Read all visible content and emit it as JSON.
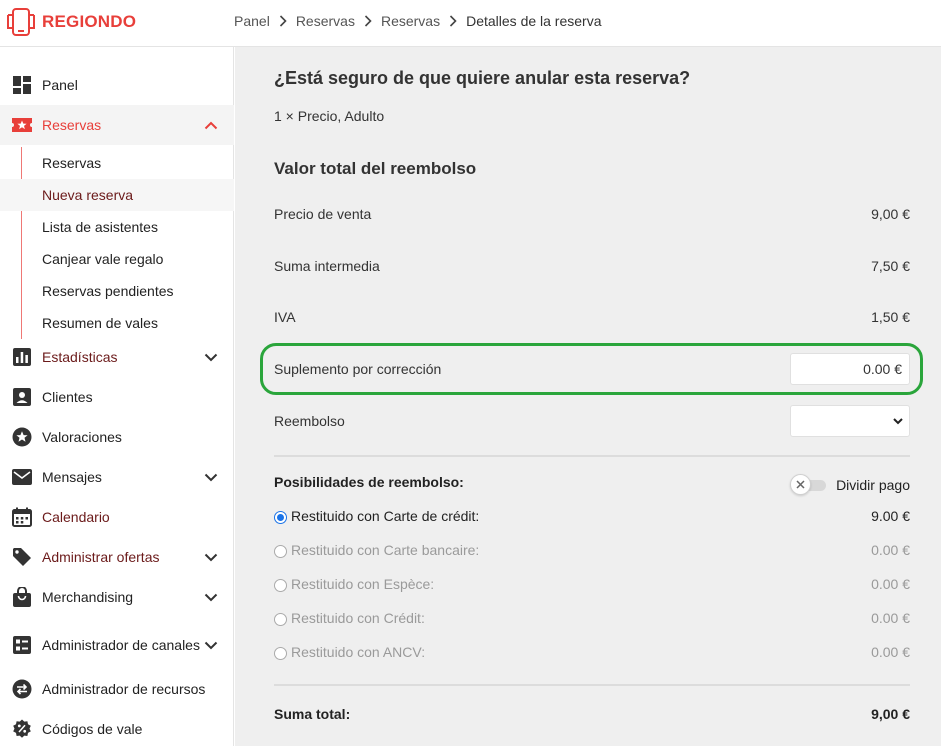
{
  "brand": {
    "name": "REGIONDO",
    "color": "#e83f3a"
  },
  "breadcrumb": [
    "Panel",
    "Reservas",
    "Reservas",
    "Detalles de la reserva"
  ],
  "sidebar": {
    "items": [
      {
        "label": "Panel",
        "icon": "dashboard-icon"
      },
      {
        "label": "Reservas",
        "icon": "star-ticket-icon"
      },
      {
        "label": "Estadísticas",
        "icon": "bar-chart-icon"
      },
      {
        "label": "Clientes",
        "icon": "contact-card-icon"
      },
      {
        "label": "Valoraciones",
        "icon": "star-circle-icon"
      },
      {
        "label": "Mensajes",
        "icon": "mail-icon"
      },
      {
        "label": "Calendario",
        "icon": "calendar-icon"
      },
      {
        "label": "Administrar ofertas",
        "icon": "tag-icon"
      },
      {
        "label": "Merchandising",
        "icon": "shopping-bag-icon"
      },
      {
        "label": "Administrador de canales",
        "icon": "channels-icon"
      },
      {
        "label": "Administrador de recursos",
        "icon": "swap-icon"
      },
      {
        "label": "Códigos de vale",
        "icon": "percent-icon"
      }
    ],
    "reservas_sub": [
      "Reservas",
      "Nueva reserva",
      "Lista de asistentes",
      "Canjear vale regalo",
      "Reservas pendientes",
      "Resumen de vales"
    ]
  },
  "main": {
    "question": "¿Está seguro de que quiere anular esta reserva?",
    "item_line": "1 × Precio, Adulto",
    "refund_heading": "Valor total del reembolso",
    "rows": [
      {
        "label": "Precio de venta",
        "value": "9,00 €"
      },
      {
        "label": "Suma intermedia",
        "value": "7,50 €"
      },
      {
        "label": "IVA",
        "value": "1,50 €"
      }
    ],
    "correction": {
      "label": "Suplemento por corrección",
      "value": "0.00  €"
    },
    "refund_label": "Reembolso",
    "refund_select_value": "",
    "options_title": "Posibilidades de reembolso:",
    "split_payment_label": "Dividir pago",
    "options": [
      {
        "label": "Restituido con Carte de crédit:",
        "value": "9.00 €",
        "checked": true
      },
      {
        "label": "Restituido con Carte bancaire:",
        "value": "0.00 €",
        "checked": false
      },
      {
        "label": "Restituido con Espèce:",
        "value": "0.00 €",
        "checked": false
      },
      {
        "label": "Restituido con Crédit:",
        "value": "0.00 €",
        "checked": false
      },
      {
        "label": "Restituido con ANCV:",
        "value": "0.00 €",
        "checked": false
      }
    ],
    "total_label": "Suma total:",
    "total_value": "9,00 €"
  },
  "colors": {
    "accent": "#e83f3a",
    "highlight": "#2aa53b",
    "radio": "#1a73e8"
  }
}
